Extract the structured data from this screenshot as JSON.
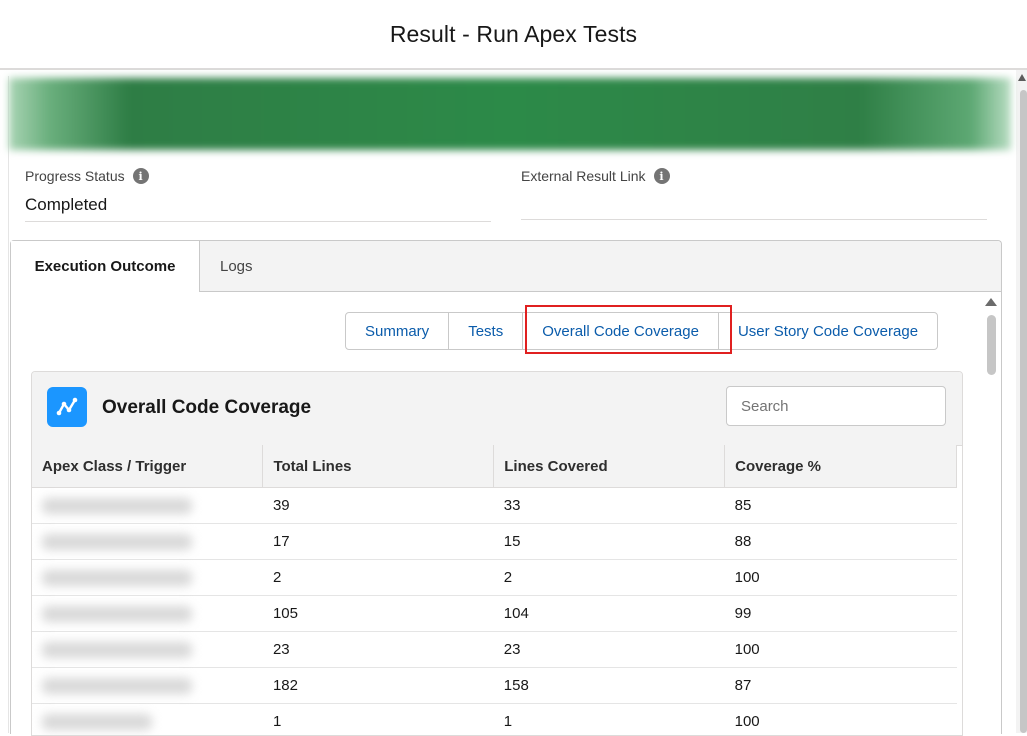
{
  "header": {
    "title": "Result - Run Apex Tests"
  },
  "fields": {
    "progress_status": {
      "label": "Progress Status",
      "value": "Completed"
    },
    "external_result_link": {
      "label": "External Result Link",
      "value": ""
    }
  },
  "tabs": [
    {
      "label": "Execution Outcome",
      "active": true
    },
    {
      "label": "Logs",
      "active": false
    }
  ],
  "subtabs": [
    {
      "label": "Summary"
    },
    {
      "label": "Tests"
    },
    {
      "label": "Overall Code Coverage",
      "selected": true
    },
    {
      "label": "User Story Code Coverage"
    }
  ],
  "coverage_card": {
    "title": "Overall Code Coverage",
    "search_placeholder": "Search",
    "columns": [
      "Apex Class / Trigger",
      "Total Lines",
      "Lines Covered",
      "Coverage %"
    ],
    "rows": [
      {
        "total": "39",
        "covered": "33",
        "pct": "85"
      },
      {
        "total": "17",
        "covered": "15",
        "pct": "88"
      },
      {
        "total": "2",
        "covered": "2",
        "pct": "100"
      },
      {
        "total": "105",
        "covered": "104",
        "pct": "99"
      },
      {
        "total": "23",
        "covered": "23",
        "pct": "100"
      },
      {
        "total": "182",
        "covered": "158",
        "pct": "87"
      },
      {
        "total": "1",
        "covered": "1",
        "pct": "100"
      }
    ]
  },
  "colors": {
    "accent": "#0b5cab",
    "icon_bg": "#1b96ff",
    "highlight": "#e02020",
    "banner": "#2e7d45"
  }
}
